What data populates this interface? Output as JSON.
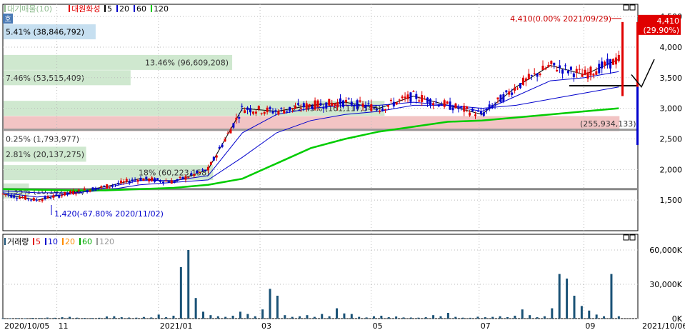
{
  "price_legend": {
    "items": [
      {
        "label": "대기매물(10)",
        "color": "#8fbc8f"
      },
      {
        "label": "대원화성",
        "color": "#e00000"
      },
      {
        "label": "5",
        "color": "#000000"
      },
      {
        "label": "20",
        "color": "#0000cc"
      },
      {
        "label": "60",
        "color": "#0000cc"
      },
      {
        "label": "120",
        "color": "#00cc00"
      }
    ]
  },
  "corner_badge": "호",
  "volume_legend": {
    "items": [
      {
        "label": "거래량",
        "color": "#1a5276"
      },
      {
        "label": "5",
        "color": "#e00000"
      },
      {
        "label": "10",
        "color": "#0000cc"
      },
      {
        "label": "20",
        "color": "#ff8c00"
      },
      {
        "label": "60",
        "color": "#00aa00"
      },
      {
        "label": "120",
        "color": "#999999"
      }
    ]
  },
  "chart_data": [
    {
      "type": "candlestick",
      "title": "대원화성",
      "y_ticks": [
        "4,500",
        "4,000",
        "3,500",
        "3,000",
        "2,500",
        "2,000",
        "1,500"
      ],
      "ylim": [
        1000,
        4700
      ],
      "x_ticks": [
        "2020/10/05",
        "11",
        "2021/01",
        "03",
        "05",
        "07",
        "09",
        "2021/10/06"
      ],
      "current_price": "4,410",
      "current_change": "(29.90%)",
      "high_annotation": "4,410(0.00% 2021/09/29)",
      "low_annotation": "1,420(-67.80% 2020/11/02)",
      "volume_profile": [
        {
          "label": "5.41% (38,846,792)",
          "price": 4250,
          "width_frac": 0.145,
          "color": "#c6dff0"
        },
        {
          "label": "13.46% (96,609,208)",
          "price": 3750,
          "width_frac": 0.36,
          "color": "#cfe8cf"
        },
        {
          "label": "7.46% (53,515,409)",
          "price": 3500,
          "width_frac": 0.2,
          "color": "#cfe8cf"
        },
        {
          "label": "22.45% (161,117,544)",
          "price": 3000,
          "width_frac": 0.6,
          "color": "#cfe8cf"
        },
        {
          "label": "(255,934,133)",
          "price": 2750,
          "width_frac": 0.97,
          "color": "#f2c4c4"
        },
        {
          "label": "0.25% (1,793,977)",
          "price": 2500,
          "width_frac": 0.12,
          "color": "#ffffff"
        },
        {
          "label": "2.81% (20,137,275)",
          "price": 2250,
          "width_frac": 0.13,
          "color": "#cfe8cf"
        },
        {
          "label": "18% (60,223,158)",
          "price": 1950,
          "width_frac": 0.33,
          "color": "#cfe8cf"
        },
        {
          "label": "1.35% (10,142,846)",
          "price": 1650,
          "width_frac": 0.04,
          "color": "#cfe8cf"
        }
      ],
      "reference_lines": [
        2650,
        1680
      ],
      "series": [
        {
          "name": "5",
          "values": [
            1600,
            1500,
            1620,
            1720,
            1850,
            1800,
            2000,
            3000,
            2950,
            3050,
            3100,
            3000,
            3200,
            3050,
            2900,
            3350,
            3700,
            3550,
            3800
          ]
        },
        {
          "name": "20",
          "values": [
            1620,
            1550,
            1600,
            1700,
            1820,
            1820,
            1900,
            2600,
            2900,
            3000,
            3050,
            3050,
            3100,
            3050,
            2950,
            3200,
            3450,
            3500,
            3600
          ]
        },
        {
          "name": "60",
          "values": [
            1650,
            1620,
            1620,
            1660,
            1750,
            1790,
            1830,
            2200,
            2600,
            2800,
            2900,
            2950,
            3050,
            3050,
            3000,
            3050,
            3150,
            3250,
            3350
          ]
        },
        {
          "name": "120",
          "values": [
            1680,
            1670,
            1660,
            1660,
            1680,
            1700,
            1750,
            1850,
            2100,
            2350,
            2500,
            2620,
            2700,
            2780,
            2800,
            2850,
            2900,
            2950,
            3000
          ]
        }
      ]
    },
    {
      "type": "bar",
      "title": "거래량",
      "y_ticks": [
        "60,000K",
        "30,000K",
        "0K"
      ],
      "ylim": [
        0,
        65000
      ],
      "values": [
        300,
        200,
        400,
        300,
        600,
        500,
        900,
        700,
        1200,
        1500,
        800,
        600,
        500,
        700,
        1800,
        2000,
        1200,
        900,
        800,
        1400,
        1000,
        3500,
        1200,
        2500,
        45000,
        60000,
        18000,
        6000,
        3000,
        2000,
        1500,
        2500,
        6000,
        4000,
        2000,
        8000,
        26000,
        20000,
        3000,
        1500,
        2000,
        3000,
        1500,
        4000,
        2000,
        9000,
        4500,
        4000,
        1500,
        1000,
        2000,
        2500,
        1200,
        1800,
        1000,
        900,
        800,
        1200,
        3000,
        2000,
        5000,
        1500,
        800,
        700,
        1600,
        1200,
        1500,
        2000,
        1300,
        2500,
        8000,
        3000,
        1200,
        2000,
        9000,
        39000,
        35000,
        20000,
        11000,
        7000,
        3500,
        2000,
        39000,
        2000
      ]
    }
  ]
}
